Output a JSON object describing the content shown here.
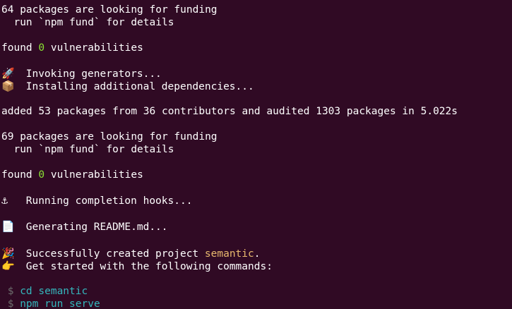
{
  "terminal": {
    "lines": {
      "l1": "64 packages are looking for funding",
      "l2": "  run `npm fund` for details",
      "l3_pre": "found ",
      "l3_num": "0",
      "l3_post": " vulnerabilities",
      "l4_icon": "🚀",
      "l4_text": " Invoking generators...",
      "l5_icon": "📦",
      "l5_text": " Installing additional dependencies...",
      "l6": "added 53 packages from 36 contributors and audited 1303 packages in 5.022s",
      "l7": "69 packages are looking for funding",
      "l8": "  run `npm fund` for details",
      "l9_pre": "found ",
      "l9_num": "0",
      "l9_post": " vulnerabilities",
      "l10_icon": "⚓",
      "l10_text": " Running completion hooks...",
      "l11_icon": "📄",
      "l11_text": " Generating README.md...",
      "l12_icon": "🎉",
      "l12_pre": " Successfully created project ",
      "l12_project": "semantic",
      "l12_post": ".",
      "l13_icon": "👉",
      "l13_text": " Get started with the following commands:",
      "cmd1_prompt": " $ ",
      "cmd1": "cd semantic",
      "cmd2_prompt": " $ ",
      "cmd2": "npm run serve"
    },
    "icons": {
      "rocket": "rocket-icon",
      "package": "package-icon",
      "anchor": "anchor-icon",
      "document": "document-icon",
      "party": "party-popper-icon",
      "pointer": "pointing-hand-icon"
    },
    "colors": {
      "background": "#300a24",
      "text": "#ffffff",
      "success_number": "#8ae234",
      "project_name": "#e9b96e",
      "command": "#34b7bd",
      "prompt": "#6d6d6d"
    }
  }
}
